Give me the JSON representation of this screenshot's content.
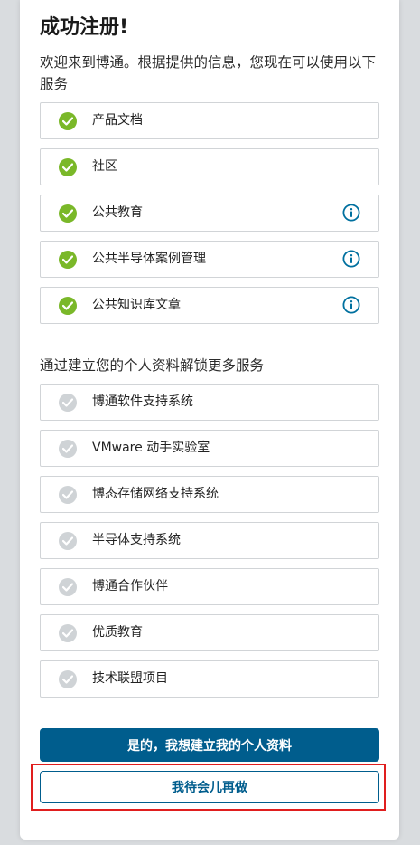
{
  "header": {
    "title": "成功注册!",
    "subtitle": "欢迎来到博通。根据提供的信息，您现在可以使用以下服务"
  },
  "available_services": [
    {
      "label": "产品文档",
      "status": "enabled",
      "has_info": false
    },
    {
      "label": "社区",
      "status": "enabled",
      "has_info": false
    },
    {
      "label": "公共教育",
      "status": "enabled",
      "has_info": true
    },
    {
      "label": "公共半导体案例管理",
      "status": "enabled",
      "has_info": true
    },
    {
      "label": "公共知识库文章",
      "status": "enabled",
      "has_info": true
    }
  ],
  "locked_section": {
    "heading": "通过建立您的个人资料解锁更多服务"
  },
  "locked_services": [
    {
      "label": "博通软件支持系统",
      "status": "locked"
    },
    {
      "label": "VMware 动手实验室",
      "status": "locked"
    },
    {
      "label": "博态存储网络支持系统",
      "status": "locked"
    },
    {
      "label": "半导体支持系统",
      "status": "locked"
    },
    {
      "label": "博通合作伙伴",
      "status": "locked"
    },
    {
      "label": "优质教育",
      "status": "locked"
    },
    {
      "label": "技术联盟项目",
      "status": "locked"
    }
  ],
  "actions": {
    "primary_label": "是的，我想建立我的个人资料",
    "secondary_label": "我待会儿再做"
  },
  "colors": {
    "enabled_check": "#7ab829",
    "locked_check": "#cfd3d6",
    "primary_button": "#005d8d",
    "info_icon": "#00709f",
    "highlight": "#e01e1e"
  }
}
